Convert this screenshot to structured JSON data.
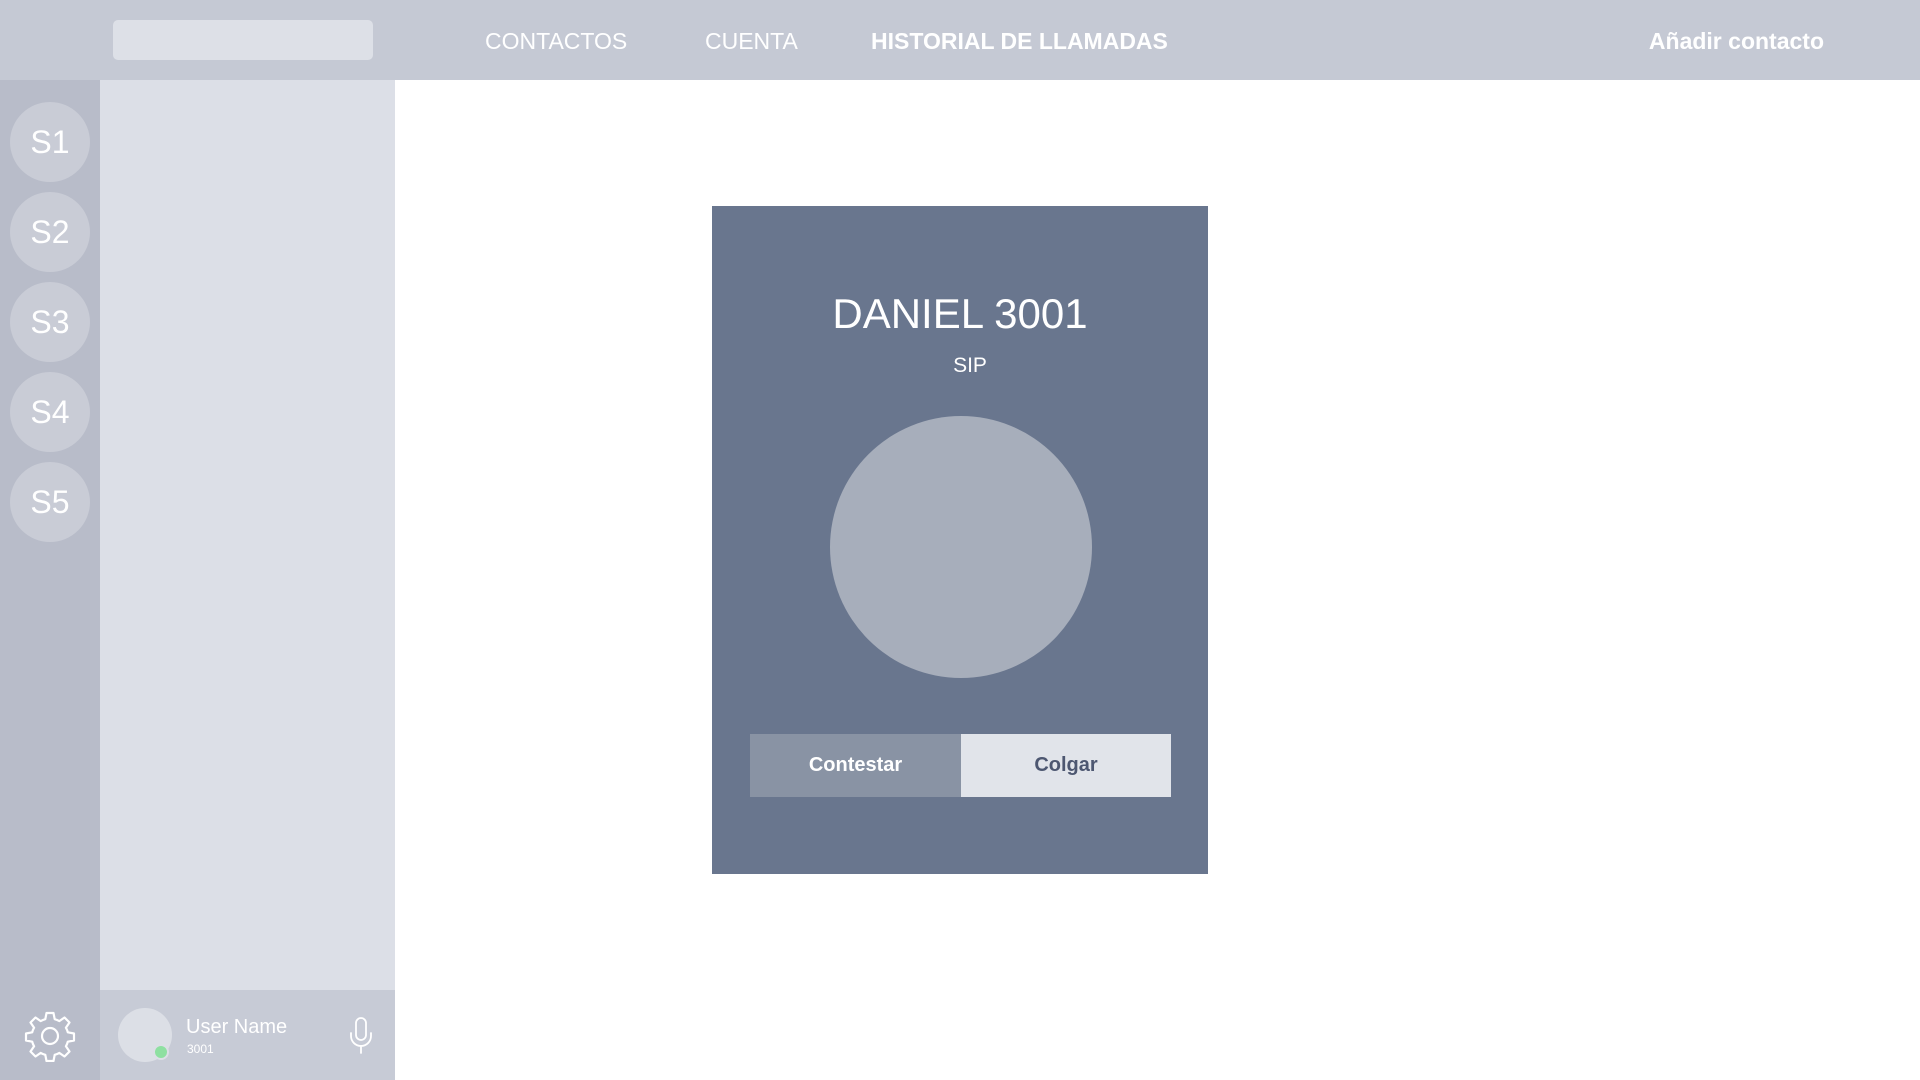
{
  "header": {
    "search": {
      "value": "",
      "placeholder": ""
    },
    "nav": [
      {
        "label": "CONTACTOS",
        "active": false
      },
      {
        "label": "CUENTA",
        "active": false
      },
      {
        "label": "HISTORIAL DE LLAMADAS",
        "active": true
      }
    ],
    "add_contact_label": "Añadir contacto"
  },
  "servers": [
    "S1",
    "S2",
    "S3",
    "S4",
    "S5"
  ],
  "settings_icon": "gear-icon",
  "user": {
    "name": "User Name",
    "extension": "3001",
    "status": "online",
    "status_color": "#8ee0a1",
    "mic_icon": "microphone-icon"
  },
  "call": {
    "caller_name": "DANIEL 3001",
    "protocol": "SIP",
    "answer_label": "Contestar",
    "hangup_label": "Colgar"
  },
  "colors": {
    "topbar": "#c5c9d4",
    "rail": "#b8bcc9",
    "sidebar": "#dcdfe7",
    "card": "#69768e",
    "answer_button": "#8993a4",
    "hangup_button": "#e1e4ea"
  }
}
